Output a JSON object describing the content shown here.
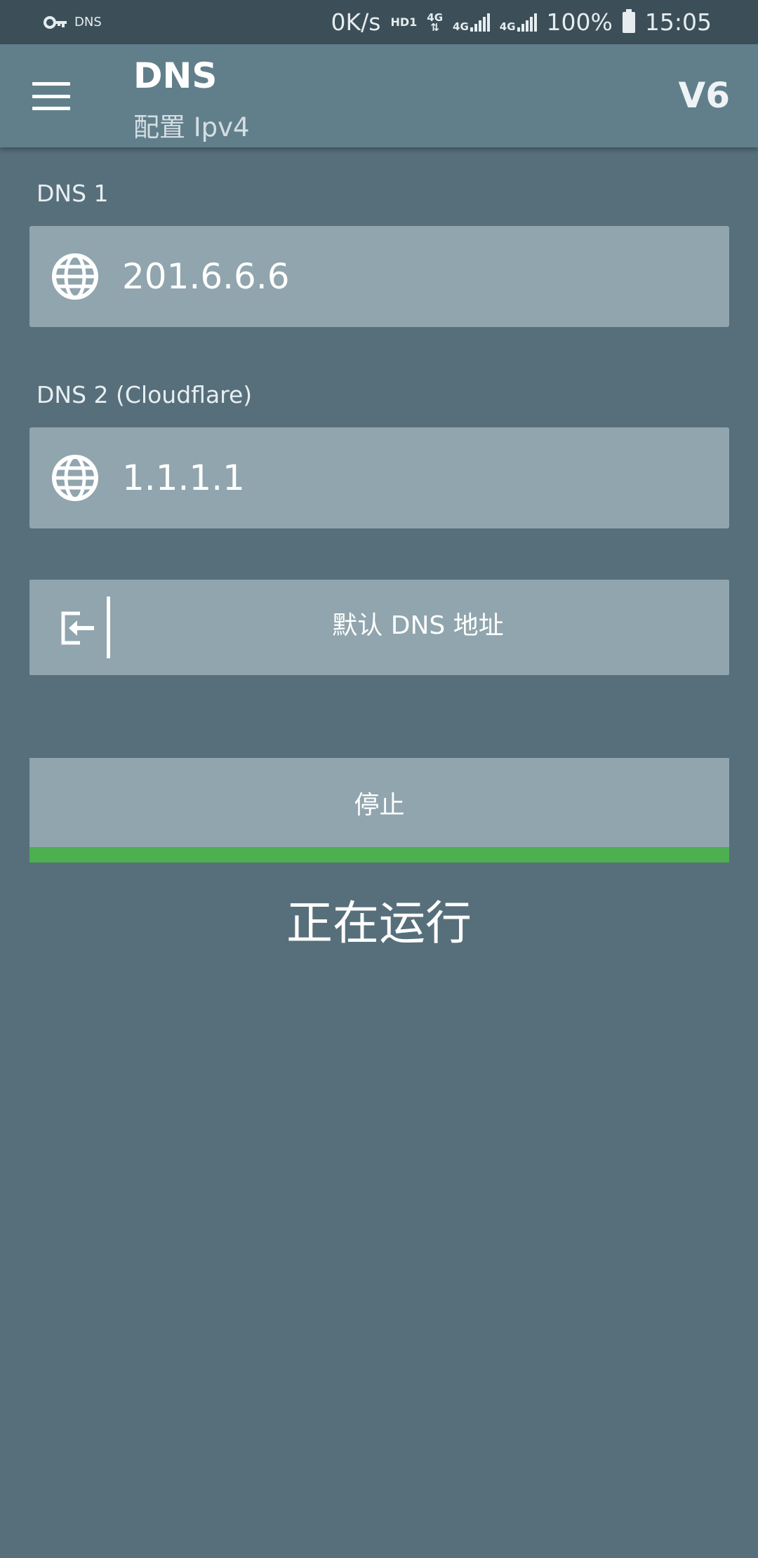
{
  "status_bar": {
    "vpn_label": "DNS",
    "speed": "0K/s",
    "hd": "HD1",
    "net1": "4G",
    "net2": "4G",
    "net3": "4G",
    "battery": "100%",
    "time": "15:05",
    "icons": [
      "key-icon",
      "signal-icon",
      "battery-icon"
    ]
  },
  "app_bar": {
    "title": "DNS",
    "subtitle": "配置 Ipv4",
    "v6_label": "V6",
    "icons": [
      "menu-icon"
    ]
  },
  "dns1": {
    "label": "DNS 1",
    "value": "201.6.6.6",
    "icon": "globe-icon"
  },
  "dns2": {
    "label": "DNS 2 (Cloudflare)",
    "value": "1.1.1.1",
    "icon": "globe-icon"
  },
  "default_button": {
    "label": "默认 DNS 地址",
    "icon": "import-icon"
  },
  "stop_button": {
    "label": "停止"
  },
  "progress": {
    "value": 1.0,
    "color": "#4caf50"
  },
  "status": {
    "text": "正在运行"
  },
  "colors": {
    "background": "#566f7b",
    "app_bar": "#617f8b",
    "status_bar": "#3c4f58",
    "field": "#90a5ad"
  }
}
